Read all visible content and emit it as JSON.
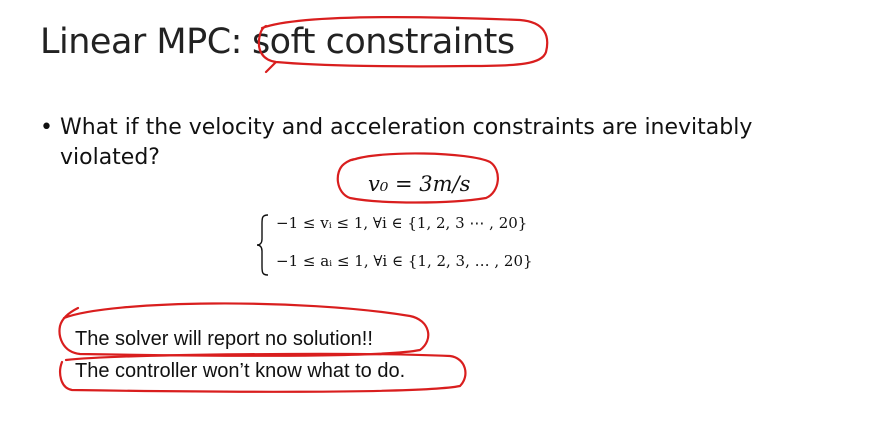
{
  "slide": {
    "title_prefix": "Linear MPC:",
    "title_emphasis": "soft constraints",
    "bullet_symbol": "•",
    "bullet_text": "What if the velocity and acceleration constraints are inevitably violated?",
    "initial_velocity": "v₀ = 3m/s",
    "constraints": [
      "−1 ≤ vᵢ ≤ 1, ∀i ∈ {1, 2, 3 ⋯ , 20}",
      "−1 ≤ aᵢ ≤ 1, ∀i ∈ {1, 2, 3, … , 20}"
    ],
    "notes": [
      "The solver will report no solution!!",
      "The controller won’t know what to do."
    ],
    "annotation_color": "#d91e1e"
  }
}
